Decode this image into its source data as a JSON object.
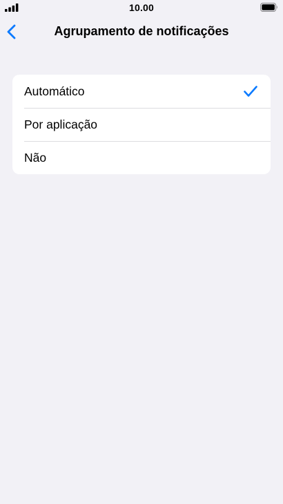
{
  "status_bar": {
    "time": "10.00",
    "signal_icon": "cellular-signal-icon",
    "battery_icon": "battery-full-icon"
  },
  "nav": {
    "back_icon": "chevron-left-icon",
    "title": "Agrupamento de notificações"
  },
  "options": [
    {
      "label": "Automático",
      "selected": true
    },
    {
      "label": "Por aplicação",
      "selected": false
    },
    {
      "label": "Não",
      "selected": false
    }
  ],
  "colors": {
    "background": "#f2f1f6",
    "card": "#ffffff",
    "accent": "#0a7aff",
    "separator": "#dcdce0"
  }
}
